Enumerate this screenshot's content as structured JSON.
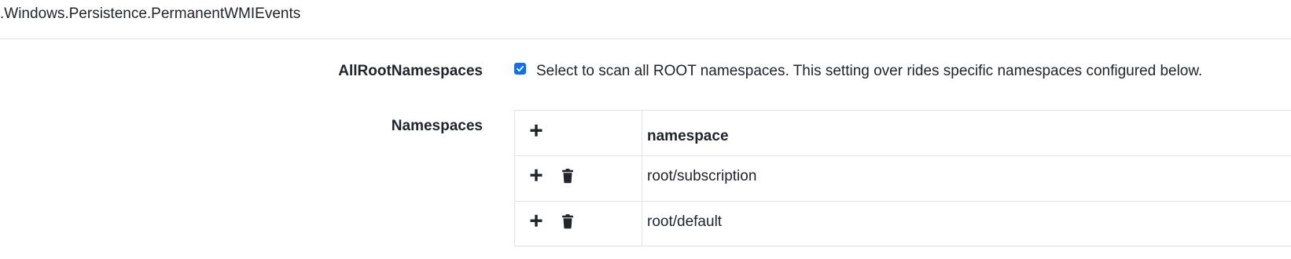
{
  "artifact": {
    "title": ".Windows.Persistence.PermanentWMIEvents"
  },
  "params": {
    "all_root_namespaces": {
      "label": "AllRootNamespaces",
      "checked": true,
      "description": "Select to scan all ROOT namespaces. This setting over rides specific namespaces configured below."
    },
    "namespaces": {
      "label": "Namespaces",
      "column_header": "namespace",
      "rows": [
        {
          "value": "root/subscription"
        },
        {
          "value": "root/default"
        }
      ]
    }
  },
  "icons": {
    "add": "plus-icon",
    "delete": "trash-icon"
  },
  "colors": {
    "checkbox": "#0d6efd",
    "border": "#dee2e6",
    "text": "#212529"
  }
}
